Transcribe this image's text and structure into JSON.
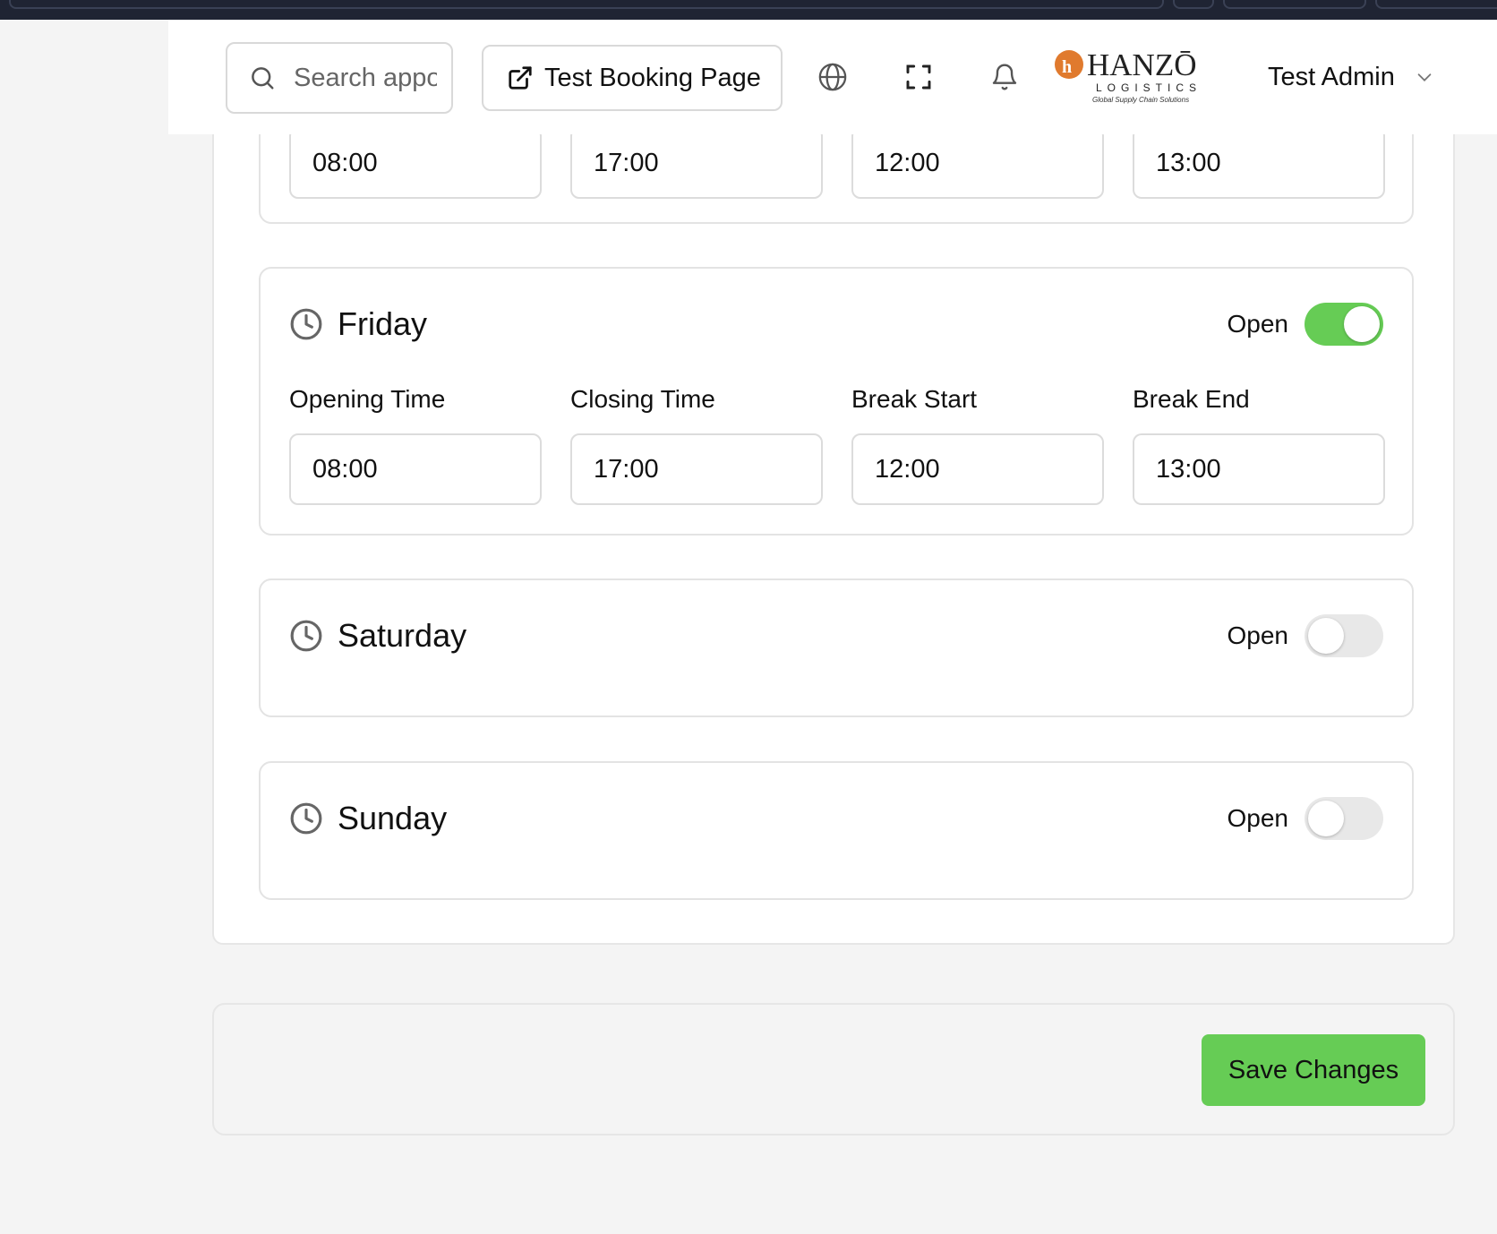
{
  "header": {
    "search_placeholder": "Search appointments",
    "booking_button_label": "Test Booking Page",
    "user_name": "Test Admin",
    "logo": {
      "brand": "HANZŌ",
      "sub": "LOGISTICS",
      "tagline": "Global Supply Chain Solutions",
      "accent": "#e07a2e"
    }
  },
  "schedule": {
    "field_labels": {
      "opening": "Opening Time",
      "closing": "Closing Time",
      "break_start": "Break Start",
      "break_end": "Break End"
    },
    "open_label": "Open",
    "partial_day": {
      "opening": "08:00",
      "closing": "17:00",
      "break_start": "12:00",
      "break_end": "13:00"
    },
    "days": [
      {
        "name": "Friday",
        "open": true,
        "opening": "08:00",
        "closing": "17:00",
        "break_start": "12:00",
        "break_end": "13:00"
      },
      {
        "name": "Saturday",
        "open": false
      },
      {
        "name": "Sunday",
        "open": false
      }
    ]
  },
  "footer": {
    "save_label": "Save Changes"
  },
  "colors": {
    "toggle_on": "#66cc55",
    "toggle_off": "#e8e8e8",
    "save_button": "#66cc55"
  }
}
